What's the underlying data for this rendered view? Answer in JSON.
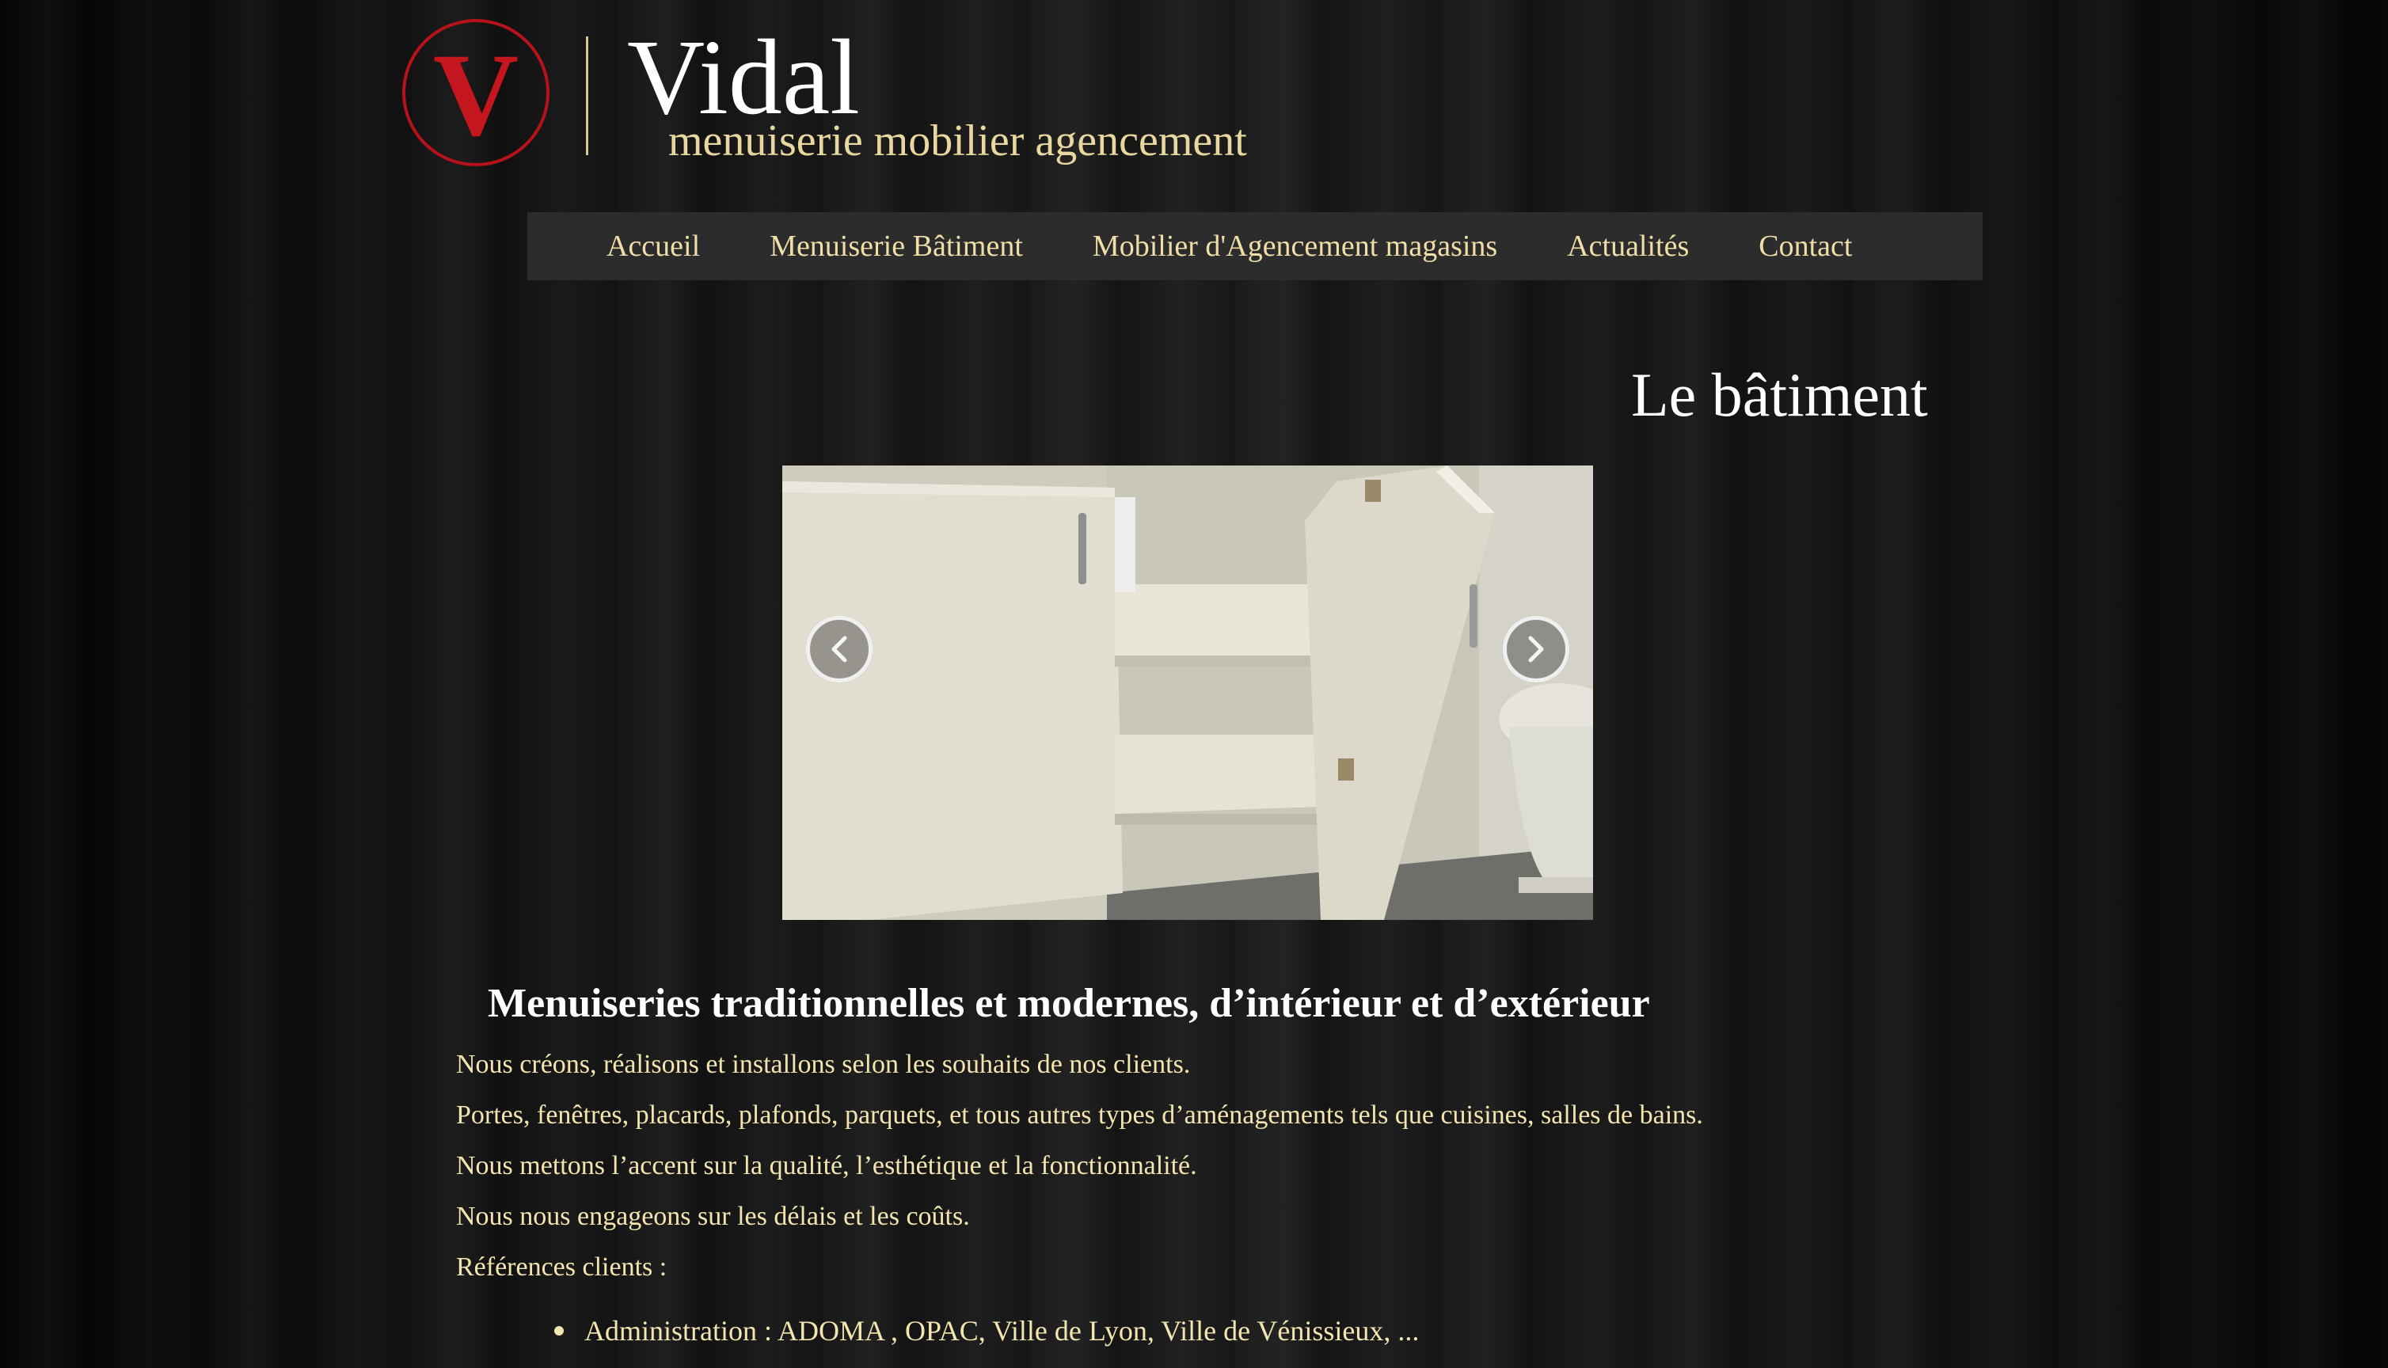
{
  "logo": {
    "letter": "V",
    "name": "Vidal",
    "tagline": "menuiserie mobilier agencement"
  },
  "nav": {
    "items": [
      {
        "label": "Accueil"
      },
      {
        "label": "Menuiserie Bâtiment"
      },
      {
        "label": "Mobilier d'Agencement magasins"
      },
      {
        "label": "Actualités"
      },
      {
        "label": "Contact"
      }
    ]
  },
  "page_title": "Le bâtiment",
  "slider": {
    "prev_icon": "chevron-left-icon",
    "next_icon": "chevron-right-icon"
  },
  "content": {
    "heading": "Menuiseries traditionnelles et modernes, d’intérieur et d’extérieur",
    "paragraphs": [
      "Nous créons, réalisons et installons selon les souhaits de nos clients.",
      "Portes, fenêtres, placards, plafonds, parquets, et tous autres types d’aménagements tels que cuisines, salles de bains.",
      "Nous mettons l’accent sur la qualité, l’esthétique et la fonctionnalité.",
      "Nous nous engageons sur les délais et les coûts.",
      "Références clients :"
    ],
    "bullets": [
      "Administration : ADOMA , OPAC, Ville de Lyon, Ville de Vénissieux, ..."
    ]
  },
  "colors": {
    "accent_red": "#b5121b",
    "nav_text": "#efdfa7",
    "body_text": "#f3e5b0",
    "nav_bg": "#2c2c2c"
  }
}
